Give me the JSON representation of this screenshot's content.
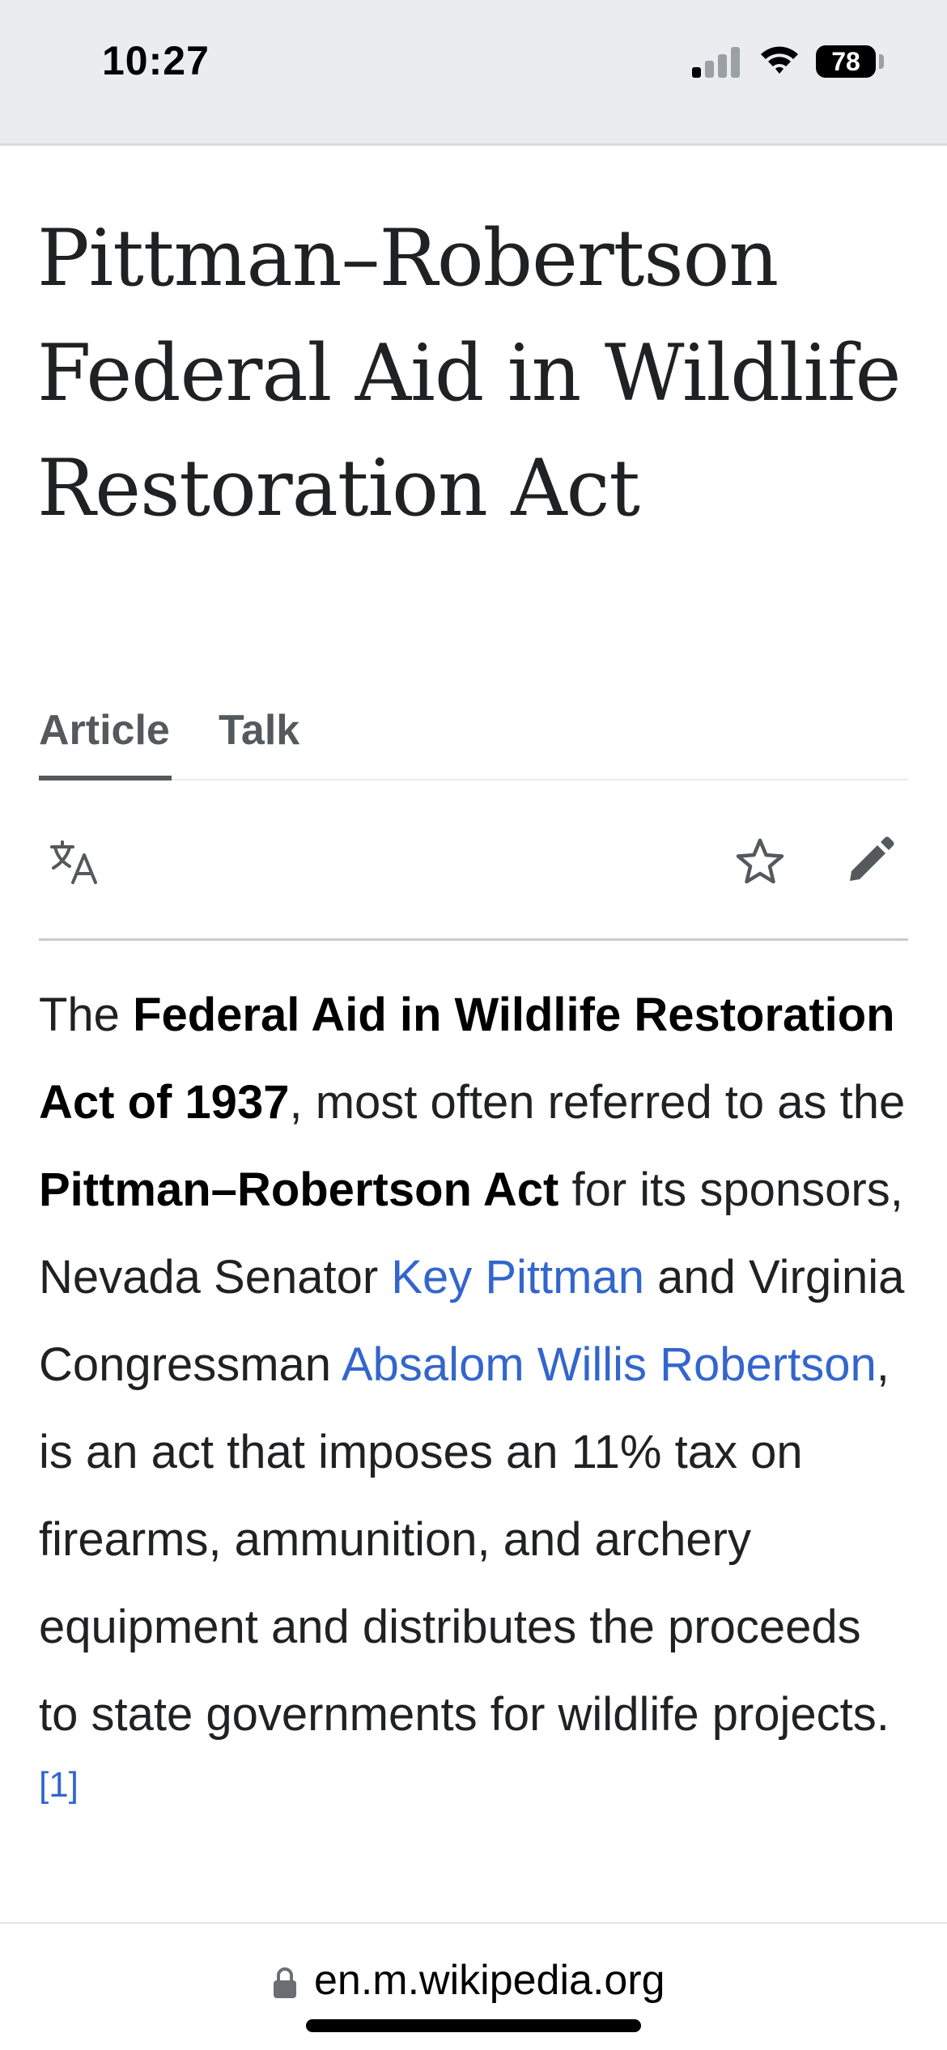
{
  "status_bar": {
    "time": "10:27",
    "battery": "78"
  },
  "article": {
    "title": "Pittman–Robertson Federal Aid in Wildlife Restoration Act",
    "tabs": [
      {
        "label": "Article",
        "selected": true
      },
      {
        "label": "Talk",
        "selected": false
      }
    ],
    "toolbar": {
      "language_icon": "translate-icon",
      "watch_icon": "star-icon",
      "edit_icon": "pencil-icon"
    },
    "lead": {
      "t1": "The ",
      "b1": "Federal Aid in Wildlife Restoration Act of 1937",
      "t2": ", most often referred to as the ",
      "b2": "Pittman–Robertson Act",
      "t3": " for its sponsors, Nevada Senator ",
      "link1": "Key Pittman",
      "t4": " and Virginia Congressman ",
      "link2": "Absalom Willis Robertson",
      "t5": ", is an act that imposes an 11% tax on firearms, ammunition, and archery equipment and distributes the proceeds to state governments for wildlife projects.",
      "ref": "[1]"
    }
  },
  "browser": {
    "url": "en.m.wikipedia.org",
    "lock_icon": "lock-icon"
  },
  "colors": {
    "link": "#3366cc",
    "text": "#202122",
    "status_bg": "#eaecf0"
  }
}
